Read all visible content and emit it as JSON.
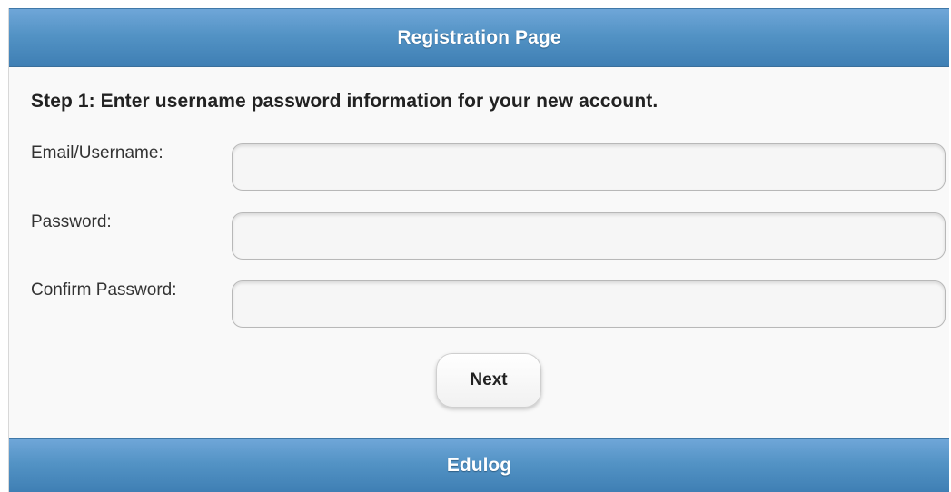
{
  "header": {
    "title": "Registration Page"
  },
  "form": {
    "step_heading": "Step 1: Enter username password information for your new account.",
    "fields": [
      {
        "label": "Email/Username:",
        "value": ""
      },
      {
        "label": "Password:",
        "value": ""
      },
      {
        "label": "Confirm Password:",
        "value": ""
      }
    ],
    "next_label": "Next"
  },
  "footer": {
    "title": "Edulog"
  },
  "colors": {
    "header_blue": "#5393c5",
    "page_background": "#f9f9f9"
  }
}
